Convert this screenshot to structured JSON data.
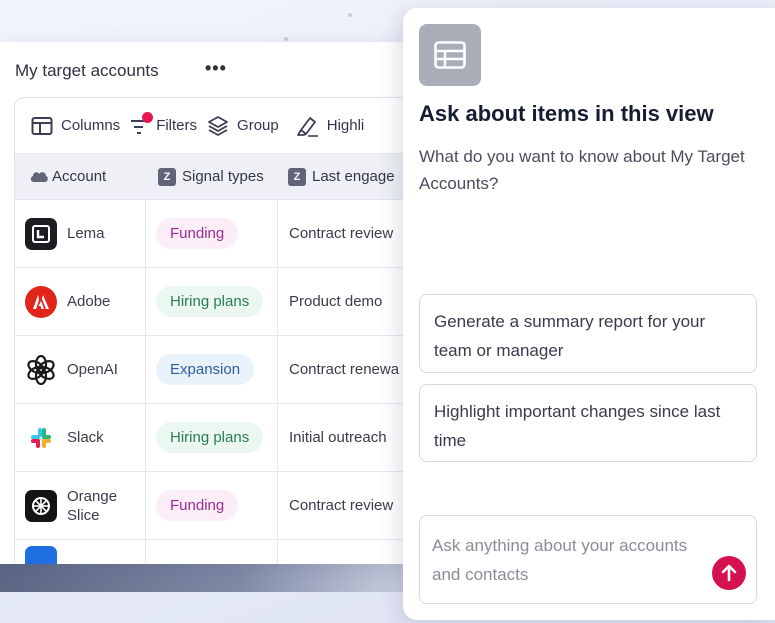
{
  "accounts_card": {
    "title": "My target accounts",
    "more_label": "•••",
    "toolbar": {
      "columns": "Columns",
      "filters": "Filters",
      "group": "Group",
      "highlight": "Highli"
    },
    "columns": {
      "account": "Account",
      "signal_types": "Signal types",
      "last_engagement": "Last engage"
    },
    "rows": [
      {
        "account": "Lema",
        "signal": "Funding",
        "engagement": "Contract review"
      },
      {
        "account": "Adobe",
        "signal": "Hiring plans",
        "engagement": "Product demo"
      },
      {
        "account": "OpenAI",
        "signal": "Expansion",
        "engagement": "Contract renewa"
      },
      {
        "account": "Slack",
        "signal": "Hiring plans",
        "engagement": "Initial outreach"
      },
      {
        "account": "Orange Slice",
        "signal": "Funding",
        "engagement": "Contract review"
      }
    ]
  },
  "assistant_panel": {
    "title": "Ask about items in this view",
    "subtitle": "What do you want to know about My Target Accounts?",
    "suggestions": [
      "Generate a summary report for your team or manager",
      "Highlight important changes since last time"
    ],
    "input_placeholder": "Ask anything about your accounts and contacts"
  },
  "colors": {
    "accent": "#d4124f",
    "funding_pill": "#fbeef9",
    "hiring_pill": "#ebf7f1",
    "expansion_pill": "#e9f1fb"
  }
}
